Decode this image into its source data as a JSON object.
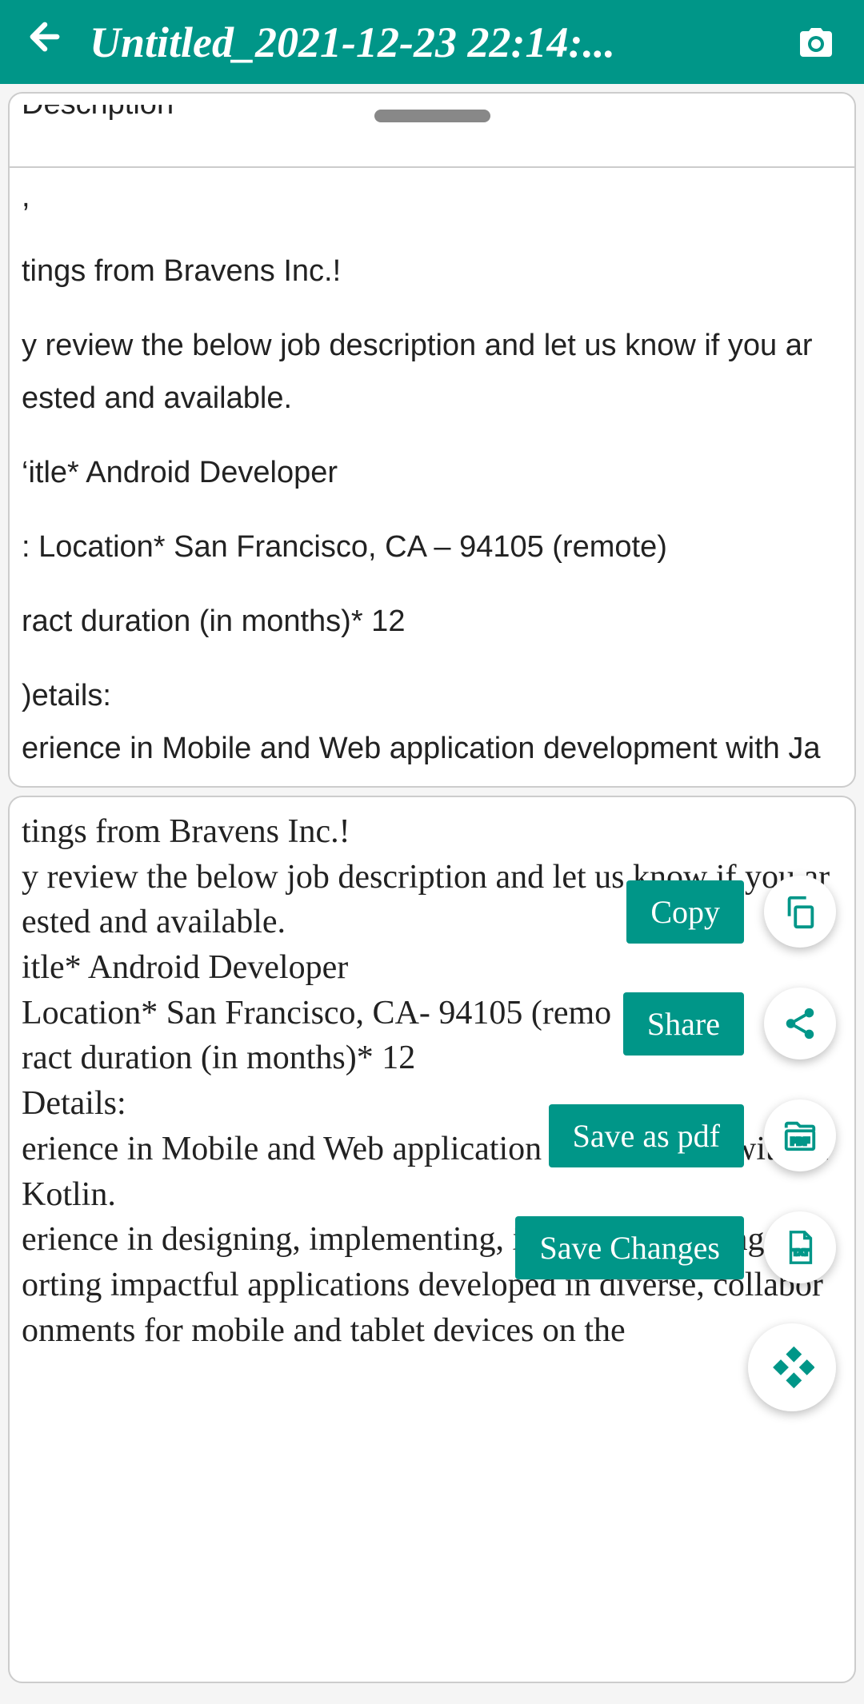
{
  "header": {
    "title": "Untitled_2021-12-23 22:14:..."
  },
  "upper": {
    "cutoff": "Description",
    "comma": ",",
    "line1": "tings from Bravens Inc.!",
    "line2": "y review the below job description and let us know if you ar",
    "line3": "ested and available.",
    "line4": "‘itle* Android Developer",
    "line5": ": Location* San Francisco, CA – 94105 (remote)",
    "line6": "ract duration (in months)* 12",
    "line7": ")etails:",
    "line8": "erience in Mobile and Web application development with Ja"
  },
  "lower": {
    "line1": "tings from Bravens Inc.!",
    "line2": "y review the below job description and let us know if you ar",
    "line3": "ested and available.",
    "line4": "itle* Android Developer",
    "line5": "Location* San Francisco, CA- 94105 (remo",
    "line6": "ract duration (in months)* 12",
    "line7": "Details:",
    "line8": "erience in Mobile and Web application development with Ja",
    "line9": "Kotlin.",
    "line10": "erience in designing, implementing, integrating, testing and",
    "line11": "orting impactful applications developed in diverse, collabor",
    "line12": "onments for mobile and tablet devices on the"
  },
  "fabs": {
    "copy": "Copy",
    "share": "Share",
    "pdf": "Save as pdf",
    "save": "Save Changes"
  }
}
